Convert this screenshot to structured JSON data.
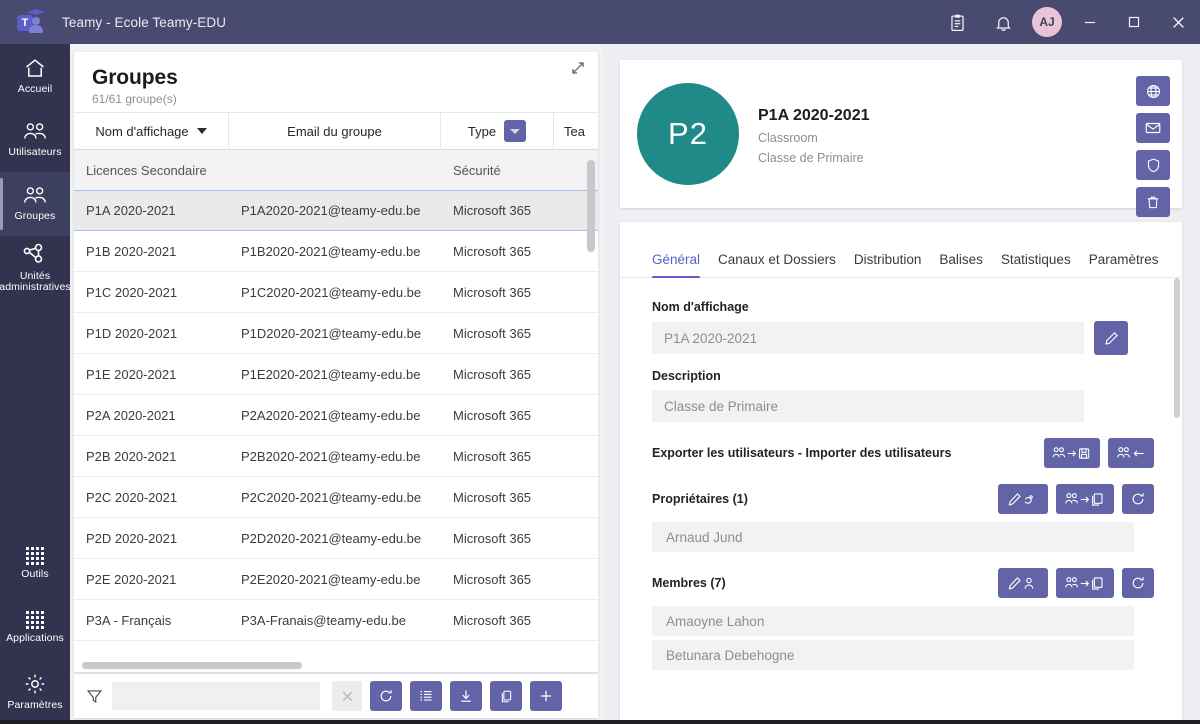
{
  "titlebar": {
    "app_title": "Teamy - Ecole Teamy-EDU",
    "logo_letter": "T",
    "icons": [
      "clipboard-icon",
      "bell-icon"
    ],
    "avatar_initials": "AJ",
    "window_minimize": "–",
    "window_maximize": "□",
    "window_close": "✕"
  },
  "rail": {
    "items": [
      {
        "label": "Accueil",
        "icon": "home-icon",
        "selected": false
      },
      {
        "label": "Utilisateurs",
        "icon": "users-icon",
        "selected": false
      },
      {
        "label": "Groupes",
        "icon": "group-icon",
        "selected": true
      },
      {
        "label": "Unités administratives",
        "icon": "org-unit-icon",
        "selected": false
      }
    ],
    "bottom_items": [
      {
        "label": "Outils",
        "icon": "grid-dots-icon"
      },
      {
        "label": "Applications",
        "icon": "grid-dots-icon"
      },
      {
        "label": "Paramètres",
        "icon": "gear-icon"
      }
    ]
  },
  "left_panel": {
    "title": "Groupes",
    "subtitle": "61/61 groupe(s)",
    "expand_icon": "expand-diagonal-icon",
    "columns": [
      "Nom d'affichage",
      "Email du groupe",
      "Type",
      "Tea"
    ],
    "sort_column": "Nom d'affichage",
    "type_filter_icon": "filter-dropdown-icon",
    "rows": [
      {
        "name": "Licences Secondaire",
        "email": "",
        "type": "Sécurité",
        "team": "",
        "state": "group"
      },
      {
        "name": "P1A 2020-2021",
        "email": "P1A2020-2021@teamy-edu.be",
        "type": "Microsoft 365",
        "team": "",
        "state": "selected"
      },
      {
        "name": "P1B 2020-2021",
        "email": "P1B2020-2021@teamy-edu.be",
        "type": "Microsoft 365",
        "team": "",
        "state": ""
      },
      {
        "name": "P1C 2020-2021",
        "email": "P1C2020-2021@teamy-edu.be",
        "type": "Microsoft 365",
        "team": "",
        "state": ""
      },
      {
        "name": "P1D 2020-2021",
        "email": "P1D2020-2021@teamy-edu.be",
        "type": "Microsoft 365",
        "team": "",
        "state": ""
      },
      {
        "name": "P1E 2020-2021",
        "email": "P1E2020-2021@teamy-edu.be",
        "type": "Microsoft 365",
        "team": "",
        "state": ""
      },
      {
        "name": "P2A 2020-2021",
        "email": "P2A2020-2021@teamy-edu.be",
        "type": "Microsoft 365",
        "team": "",
        "state": ""
      },
      {
        "name": "P2B 2020-2021",
        "email": "P2B2020-2021@teamy-edu.be",
        "type": "Microsoft 365",
        "team": "",
        "state": ""
      },
      {
        "name": "P2C 2020-2021",
        "email": "P2C2020-2021@teamy-edu.be",
        "type": "Microsoft 365",
        "team": "",
        "state": ""
      },
      {
        "name": "P2D 2020-2021",
        "email": "P2D2020-2021@teamy-edu.be",
        "type": "Microsoft 365",
        "team": "",
        "state": ""
      },
      {
        "name": "P2E 2020-2021",
        "email": "P2E2020-2021@teamy-edu.be",
        "type": "Microsoft 365",
        "team": "",
        "state": ""
      },
      {
        "name": "P3A - Français",
        "email": "P3A-Franais@teamy-edu.be",
        "type": "Microsoft 365",
        "team": "",
        "state": ""
      }
    ],
    "toolbar": {
      "funnel_icon": "filter-funnel-icon",
      "filter_value": "",
      "filter_placeholder": "",
      "clear_label": "✕",
      "buttons": [
        {
          "name": "refresh-button",
          "icon": "refresh-icon"
        },
        {
          "name": "list-button",
          "icon": "list-icon"
        },
        {
          "name": "download-button",
          "icon": "download-icon"
        },
        {
          "name": "copy-button",
          "icon": "copy-icon"
        },
        {
          "name": "add-button",
          "icon": "plus-icon"
        }
      ]
    }
  },
  "right_panel": {
    "avatar_text": "P2",
    "avatar_color": "#1f8a87",
    "group_name": "P1A 2020-2021",
    "group_type": "Classroom",
    "group_description": "Classe de Primaire",
    "head_actions": [
      {
        "name": "globe-button",
        "icon": "globe-icon"
      },
      {
        "name": "mail-button",
        "icon": "mail-icon"
      },
      {
        "name": "shield-button",
        "icon": "shield-icon"
      },
      {
        "name": "delete-button",
        "icon": "trash-icon"
      }
    ],
    "tabs": [
      {
        "label": "Général",
        "active": true
      },
      {
        "label": "Canaux et Dossiers",
        "active": false
      },
      {
        "label": "Distribution",
        "active": false
      },
      {
        "label": "Balises",
        "active": false
      },
      {
        "label": "Statistiques",
        "active": false
      },
      {
        "label": "Paramètres",
        "active": false
      }
    ],
    "form": {
      "display_name_label": "Nom d'affichage",
      "display_name_value": "P1A 2020-2021",
      "edit_name_icon": "pencil-icon",
      "description_label": "Description",
      "description_value": "Classe de Primaire",
      "export_import_label": "Exporter les utilisateurs - Importer des utilisateurs",
      "export_icon": "users-export-save-icon",
      "import_icon": "users-import-icon",
      "owners_label": "Propriétaires (1)",
      "owners_edit_icon": "pencil-owner-icon",
      "owners_copy_icon": "users-copy-icon",
      "owners_refresh_icon": "refresh-icon",
      "owners": [
        "Arnaud Jund"
      ],
      "members_label": "Membres (7)",
      "members_edit_icon": "pencil-member-icon",
      "members_copy_icon": "users-copy-icon",
      "members_refresh_icon": "refresh-icon",
      "members": [
        "Amaoyne Lahon",
        "Betunara Debehogne"
      ]
    }
  },
  "colors": {
    "brand": "#6264a7",
    "titlebar": "#484a70",
    "rail": "#32334e",
    "accent": "#5b5fc7",
    "avatar_teal": "#1f8a87"
  }
}
